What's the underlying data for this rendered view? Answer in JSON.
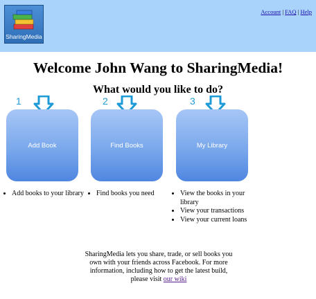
{
  "header": {
    "logo_text": "SharingMedia",
    "links": {
      "account": "Account",
      "faq": "FAQ",
      "help": "Help",
      "separator": "|"
    }
  },
  "main": {
    "welcome": "Welcome John Wang to SharingMedia!",
    "question": "What would you like to do?",
    "options": [
      {
        "number": "1",
        "label": "Add Book",
        "bullets": [
          "Add books to your library"
        ]
      },
      {
        "number": "2",
        "label": "Find Books",
        "bullets": [
          "Find books you need"
        ]
      },
      {
        "number": "3",
        "label": "My Library",
        "bullets": [
          "View the books in your library",
          "View your transactions",
          "View your current loans"
        ]
      }
    ]
  },
  "footer": {
    "text": "SharingMedia lets you share, trade, or sell books you own with your friends across Facebook. For more information, including how to get the latest build, please visit",
    "link": "our wiki"
  },
  "colors": {
    "header_bg": "#a9d3fa",
    "tile": "#7aa8ec",
    "arrow": "#1e9bd7"
  },
  "icons": {
    "logo": "books-stack-icon",
    "pointer": "arrow-down-icon"
  }
}
